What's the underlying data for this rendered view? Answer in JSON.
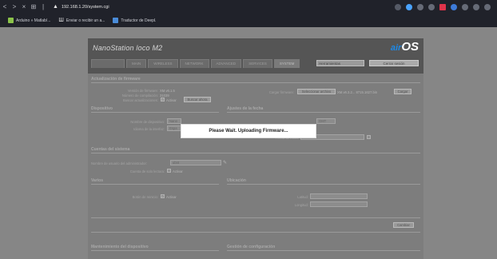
{
  "browser": {
    "back": "<",
    "forward": ">",
    "close": "×",
    "grid": "⊞",
    "sep": "|",
    "url": "192.168.1.20/system.cgi"
  },
  "bookmarks": [
    {
      "label": "Arduino » Matlab/..."
    },
    {
      "label": "Enviar o recibir un a..."
    },
    {
      "label": "Traductor de Deepl."
    }
  ],
  "header": {
    "brand": "NanoStation loco M2",
    "airos_main": "air",
    "airos_os": "OS",
    "tabs": [
      "",
      "MAIN",
      "WIRELESS",
      "NETWORK",
      "ADVANCED",
      "SERVICES",
      "SYSTEM"
    ],
    "tools_select": "Herramientas",
    "logout": "Cerrar sesión"
  },
  "firmware": {
    "title": "Actualización de firmware",
    "version_label": "Versión de firmware:",
    "version_value": "XM.v6.1.5",
    "build_label": "Número de compilación:",
    "build_value": "31039",
    "check_label": "Buscar actualizaciones:",
    "check_option": "Activar",
    "check_button": "Buscar ahora",
    "upload_label": "Cargar firmware:",
    "select_button": "Seleccionar archivo",
    "file_name": "XM.v6.3.2... 8715.1627.bin",
    "upload_button": "Cargar"
  },
  "device": {
    "title": "Dispositivo",
    "name_label": "Nombre de dispositivo:",
    "name_value": "Nano",
    "lang_label": "Idioma de la interfaz:",
    "lang_value": "Espa"
  },
  "date": {
    "title": "Ajustes de la fecha",
    "tz_value": "GMT",
    "start_label": "Fecha de inicio:"
  },
  "accounts": {
    "title": "Cuentas del sistema",
    "admin_label": "Nombre de usuario del administrador:",
    "admin_value": "ubnt",
    "ro_label": "Cuenta de solo lectura:",
    "ro_option": "Activar"
  },
  "misc": {
    "title": "Varios",
    "reset_label": "Botón de reinicio:",
    "reset_option": "Activar"
  },
  "location": {
    "title": "Ubicación",
    "lat_label": "Latitud:",
    "lon_label": "Longitud:"
  },
  "actions": {
    "change_button": "Cambiar"
  },
  "footer": {
    "maint_title": "Mantenimiento del dispositivo",
    "config_title": "Gestión de configuración"
  },
  "modal": {
    "message": "Please Wait. Uploading Firmware..."
  },
  "colors": {
    "browser_bg": "#20222a",
    "page_overlay": "#868686",
    "modal_bg": "#ffffff",
    "brand_blue": "#1e88e5"
  }
}
